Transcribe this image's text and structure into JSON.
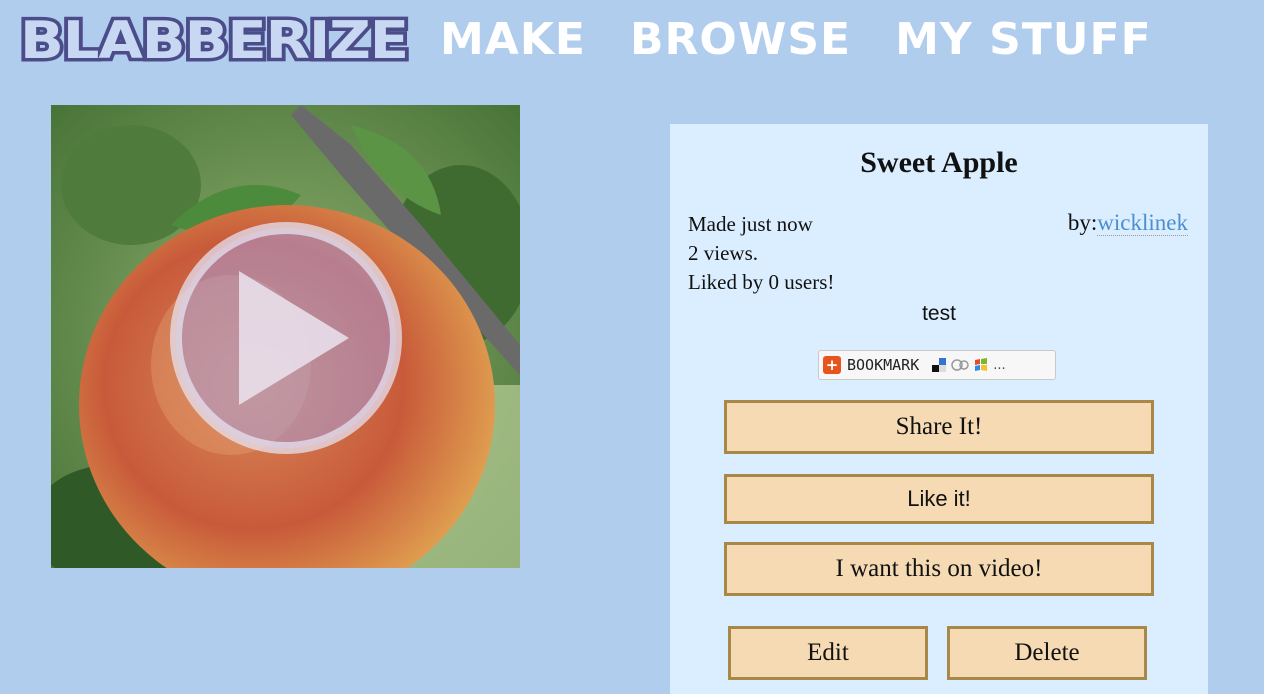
{
  "header": {
    "logo_text": "BLABBERIZE",
    "nav": [
      "MAKE",
      "BROWSE",
      "MY STUFF"
    ]
  },
  "blab": {
    "title": "Sweet Apple",
    "made": "Made just now",
    "views": "2 views.",
    "likes": "Liked by 0 users!",
    "by_label": "by:",
    "author": "wicklinek",
    "description": "test"
  },
  "bookmark": {
    "label": "BOOKMARK",
    "more": "..."
  },
  "buttons": {
    "share": "Share It!",
    "like": "Like it!",
    "video": "I want this on video!",
    "edit": "Edit",
    "delete": "Delete"
  },
  "colors": {
    "page_bg": "#b0cded",
    "panel_bg": "#dbeeff",
    "button_bg": "#f5dab4",
    "button_border": "#a88848",
    "link": "#4a8fd0",
    "logo_fill": "#5a5a96"
  }
}
